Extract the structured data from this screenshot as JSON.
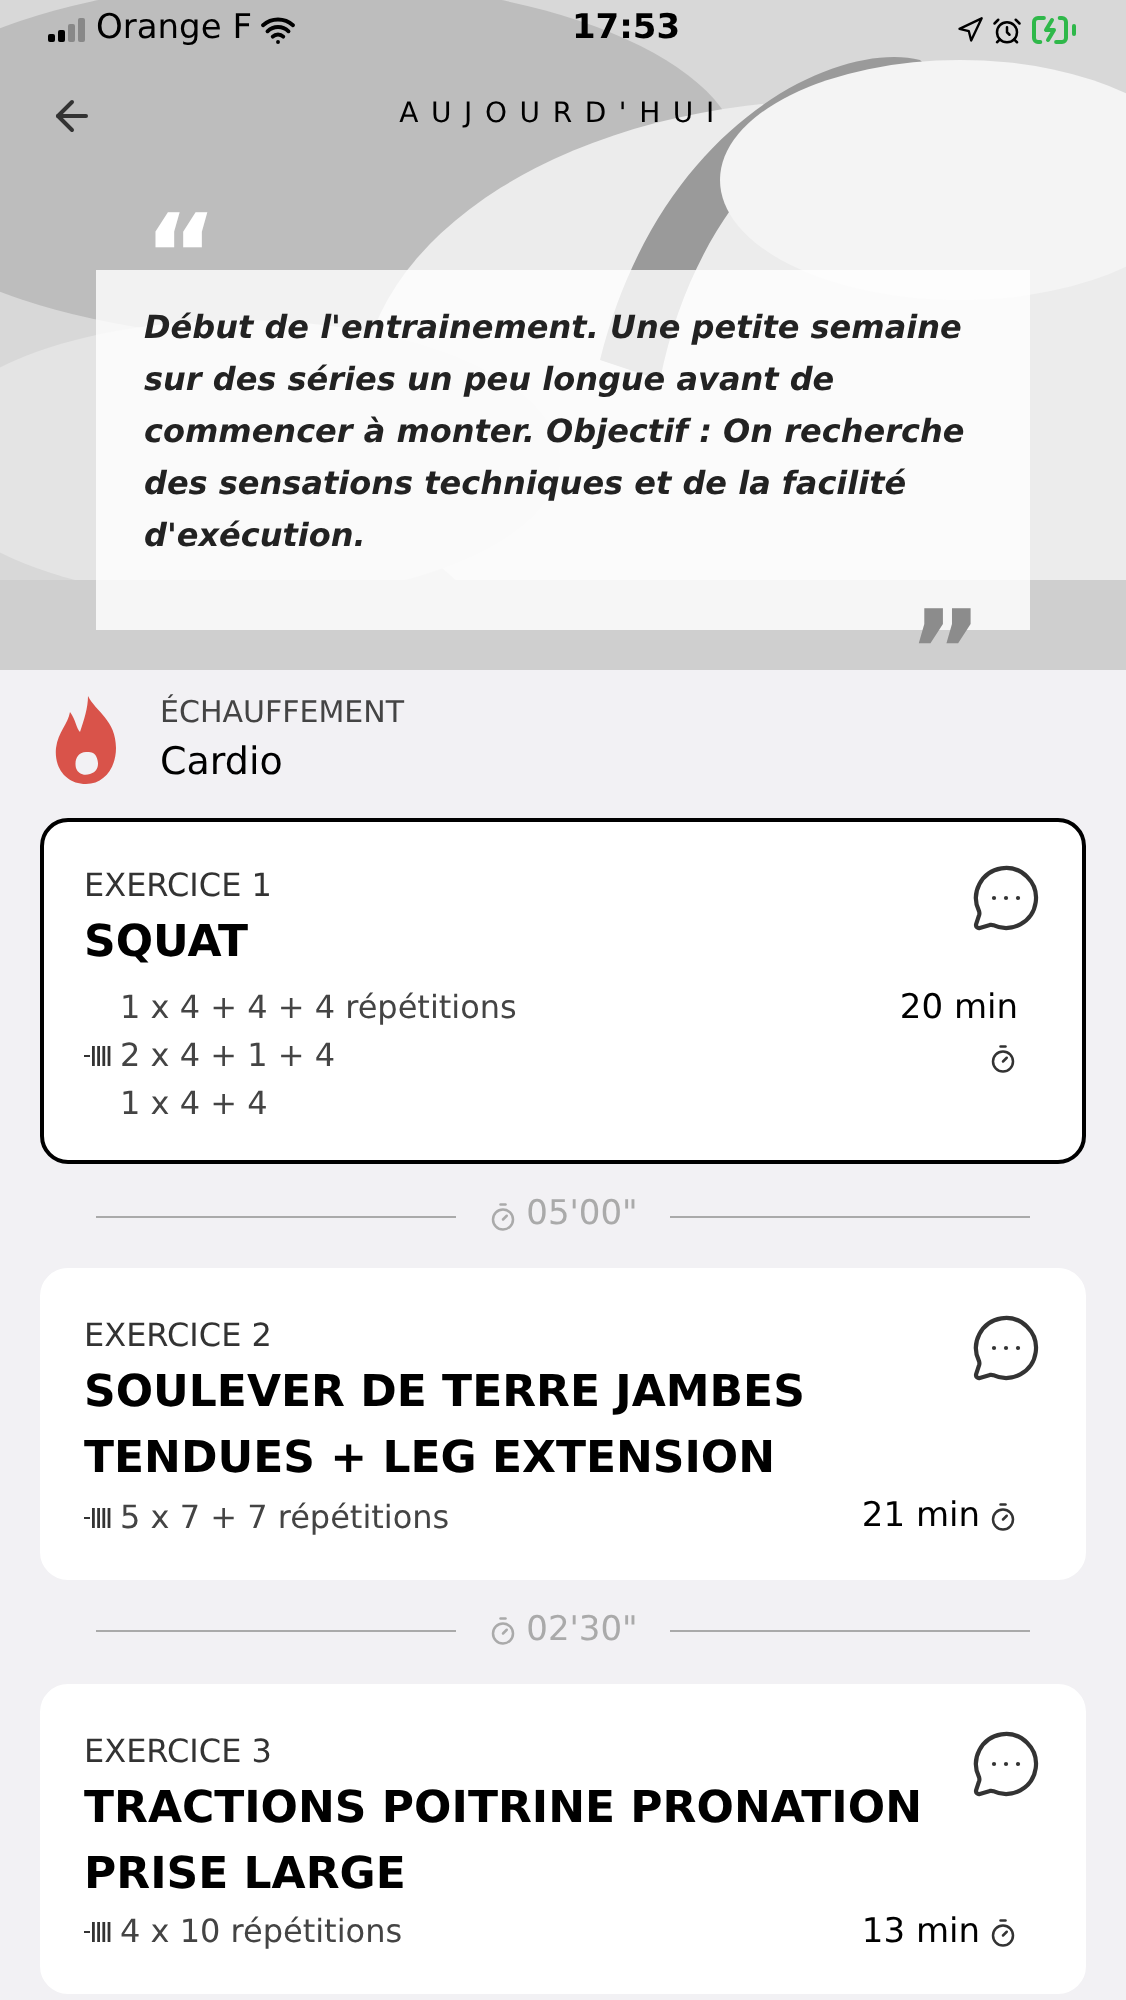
{
  "status_bar": {
    "carrier": "Orange F",
    "time": "17:53"
  },
  "header": {
    "title": "AUJOURD'HUI"
  },
  "quote": {
    "open_mark": "“",
    "text": "Début de l'entrainement. Une petite semaine sur des séries un peu longue avant de commencer à monter. Objectif : On recherche des sensations techniques et de la facilité d'exécution.",
    "close_mark": "”"
  },
  "section": {
    "label": "ÉCHAUFFEMENT",
    "name": "Cardio"
  },
  "items": [
    {
      "kind": "exercise",
      "label": "EXERCICE 1",
      "name": "SQUAT",
      "sets": [
        "1 x 4 + 4 + 4 répétitions",
        "2 x 4 + 1 + 4",
        "1 x 4 + 4"
      ],
      "duration": "20 min",
      "selected": true
    },
    {
      "kind": "rest",
      "time": "05'00\""
    },
    {
      "kind": "exercise",
      "label": "EXERCICE 2",
      "name": "SOULEVER DE TERRE JAMBES TENDUES + LEG EXTENSION",
      "sets": [
        "5 x 7 + 7 répétitions"
      ],
      "duration": "21 min",
      "selected": false
    },
    {
      "kind": "rest",
      "time": "02'30\""
    },
    {
      "kind": "exercise",
      "label": "EXERCICE 3",
      "name": "TRACTIONS POITRINE PRONATION PRISE LARGE",
      "sets": [
        "4 x 10 répétitions"
      ],
      "duration": "13 min",
      "selected": false
    }
  ]
}
